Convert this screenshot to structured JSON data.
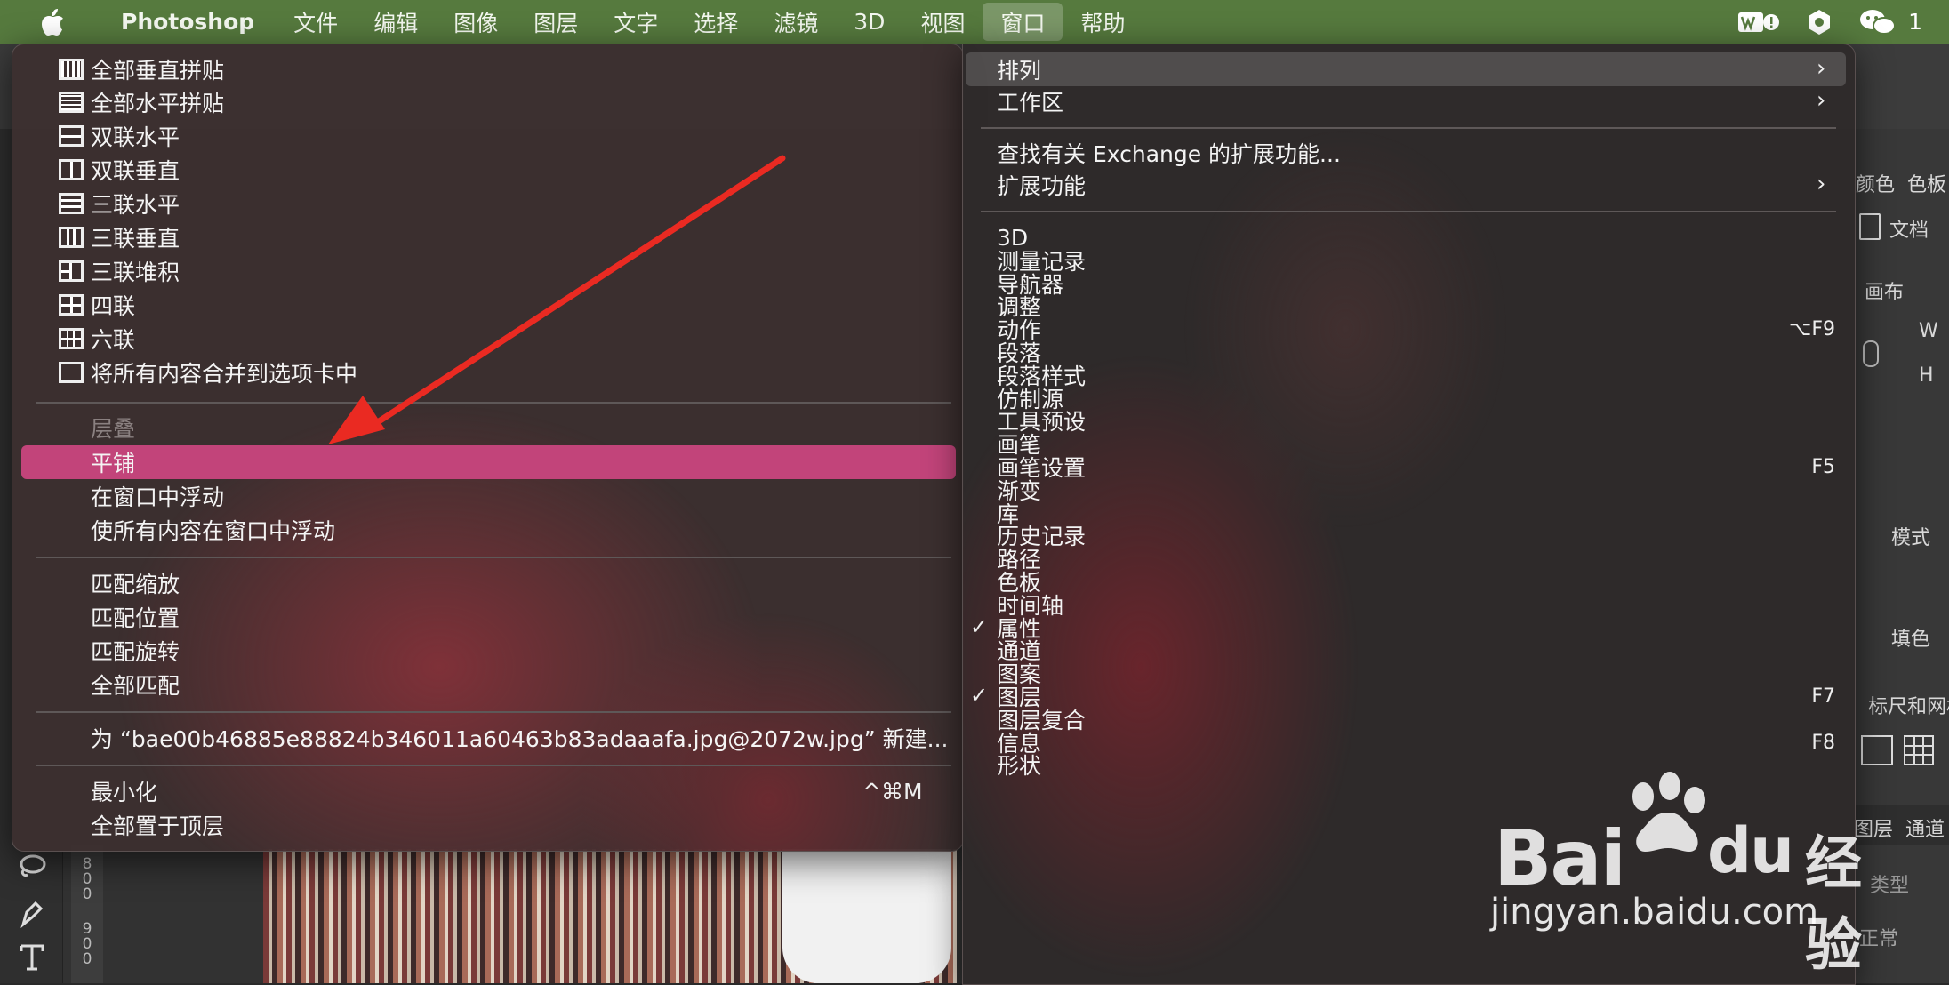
{
  "menubar": {
    "app": "Photoshop",
    "items": [
      "文件",
      "编辑",
      "图像",
      "图层",
      "文字",
      "选择",
      "滤镜",
      "3D",
      "视图",
      "窗口",
      "帮助"
    ],
    "active_index": 9,
    "status_num": "1"
  },
  "left_menu": {
    "group1": [
      {
        "label": "全部垂直拼贴",
        "icon": "tile-all-vertical-icon"
      },
      {
        "label": "全部水平拼贴",
        "icon": "tile-all-horizontal-icon"
      },
      {
        "label": "双联水平",
        "icon": "two-up-horizontal-icon"
      },
      {
        "label": "双联垂直",
        "icon": "two-up-vertical-icon"
      },
      {
        "label": "三联水平",
        "icon": "three-up-horizontal-icon"
      },
      {
        "label": "三联垂直",
        "icon": "three-up-vertical-icon"
      },
      {
        "label": "三联堆积",
        "icon": "three-up-stacked-icon"
      },
      {
        "label": "四联",
        "icon": "four-up-icon"
      },
      {
        "label": "六联",
        "icon": "six-up-icon"
      },
      {
        "label": "将所有内容合并到选项卡中",
        "icon": "consolidate-tabs-icon"
      }
    ],
    "group2": [
      {
        "label": "层叠",
        "disabled": true
      },
      {
        "label": "平铺",
        "highlighted": true
      },
      {
        "label": "在窗口中浮动"
      },
      {
        "label": "使所有内容在窗口中浮动"
      }
    ],
    "group3": [
      {
        "label": "匹配缩放"
      },
      {
        "label": "匹配位置"
      },
      {
        "label": "匹配旋转"
      },
      {
        "label": "全部匹配"
      }
    ],
    "new_window": "为 “bae00b46885e88824b346011a60463b83adaaafa.jpg@2072w.jpg” 新建...",
    "group5": [
      {
        "label": "最小化",
        "shortcut": "^⌘M"
      },
      {
        "label": "全部置于顶层"
      }
    ]
  },
  "right_menu": {
    "top": [
      {
        "label": "排列",
        "submenu": true,
        "highlighted": true
      },
      {
        "label": "工作区",
        "submenu": true
      }
    ],
    "ext": [
      {
        "label": "查找有关 Exchange 的扩展功能..."
      },
      {
        "label": "扩展功能",
        "submenu": true
      }
    ],
    "panels": [
      {
        "label": "3D"
      },
      {
        "label": "测量记录"
      },
      {
        "label": "导航器"
      },
      {
        "label": "调整"
      },
      {
        "label": "动作",
        "shortcut": "⌥F9"
      },
      {
        "label": "段落"
      },
      {
        "label": "段落样式"
      },
      {
        "label": "仿制源"
      },
      {
        "label": "工具预设"
      },
      {
        "label": "画笔"
      },
      {
        "label": "画笔设置",
        "shortcut": "F5"
      },
      {
        "label": "渐变"
      },
      {
        "label": "库"
      },
      {
        "label": "历史记录"
      },
      {
        "label": "路径"
      },
      {
        "label": "色板"
      },
      {
        "label": "时间轴"
      },
      {
        "label": "属性",
        "checked": true
      },
      {
        "label": "通道"
      },
      {
        "label": "图案"
      },
      {
        "label": "图层",
        "checked": true,
        "shortcut": "F7"
      },
      {
        "label": "图层复合"
      },
      {
        "label": "信息",
        "shortcut": "F8"
      },
      {
        "label": "形状"
      }
    ]
  },
  "right_panel": {
    "tabs": [
      "颜色",
      "色板"
    ],
    "doc_label": "文档",
    "canvas_label": "画布",
    "w_label": "W",
    "h_label": "H",
    "mode_label": "模式",
    "fill_label": "填色",
    "rulers_label": "标尺和网格",
    "layer_tabs": [
      "图层",
      "通道"
    ],
    "search_placeholder": "类型",
    "blend_mode": "正常"
  },
  "ruler": {
    "marks": [
      "8",
      "0",
      "0",
      "9",
      "0",
      "0"
    ]
  },
  "watermark": {
    "brand": "Bai",
    "brand2": "du",
    "cn": "经验",
    "url": "jingyan.baidu.com"
  }
}
